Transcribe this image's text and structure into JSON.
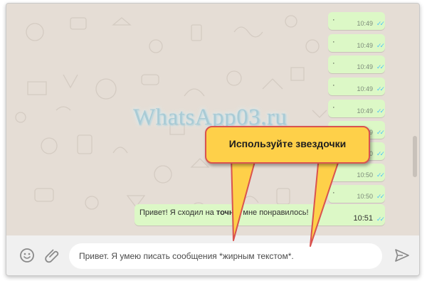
{
  "chat": {
    "watermark": "WhatsApp03.ru",
    "messages": [
      {
        "text": "·",
        "time": "10:49"
      },
      {
        "text": "·",
        "time": "10:49"
      },
      {
        "text": "·",
        "time": "10:49"
      },
      {
        "text": "·",
        "time": "10:49"
      },
      {
        "text": "·",
        "time": "10:49"
      },
      {
        "text": "·",
        "time": "10:49"
      },
      {
        "text": "·",
        "time": "10:50"
      },
      {
        "text": "·",
        "time": "10:50"
      },
      {
        "text": "·",
        "time": "10:50"
      }
    ],
    "last_message": {
      "text_before": "Привет! Я сходил на ",
      "bold_text": "точно",
      "text_after": ", мне понравилось!",
      "time": "10:51"
    },
    "read_tick": "✓✓"
  },
  "callout": {
    "label": "Используйте звездочки"
  },
  "composer": {
    "emoji_icon": "emoji-icon",
    "attach_icon": "paperclip-icon",
    "send_icon": "send-icon",
    "input_value": "Привет. Я умею писать сообщения *жирным текстом*."
  },
  "colors": {
    "chat_background": "#e5ddd5",
    "outgoing_bubble": "#dcf8c6",
    "callout_fill": "#fed049",
    "callout_border": "#d9534f",
    "read_tick": "#4fc3f7"
  }
}
